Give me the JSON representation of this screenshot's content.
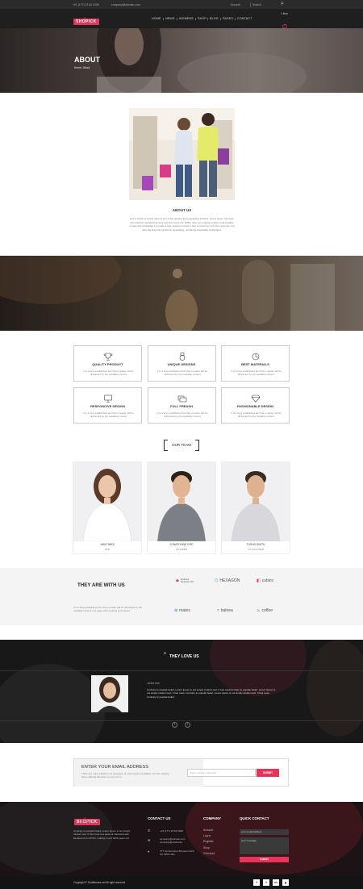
{
  "topbar": {
    "phone": "+01 (177) 23 84 0208",
    "email": "company@domain.com",
    "account": "Account",
    "search_placeholder": "Search"
  },
  "header": {
    "logo": "SHOPICK",
    "nav": [
      "HOME",
      "NEWS",
      "WOMENS",
      "SHOP",
      "BLOG",
      "PAGES",
      "CONTACT"
    ],
    "cart": "1 Item"
  },
  "hero": {
    "title": "ABOUT",
    "breadcrumb": "Home  /  About"
  },
  "about": {
    "title": "ABOUT US",
    "text": "Lorem ipsum is simply dummy text of the printing and typesetting industry. Lorem ipsum has been the industry's standard dummy text ever since the 1500s, when an unknown printer took a galley of type and scrambled it to make a type specimen book. It has survived not only five centuries, but also the leap into electronic typesetting, remaining essentially unchanged."
  },
  "features": [
    {
      "title": "QUALITY PRODUCT",
      "icon": "trophy-icon",
      "desc": "It is a long established fact that a reader will be distracted by the readable content"
    },
    {
      "title": "UNIQUE DESIGNS",
      "icon": "medal-icon",
      "desc": "It is a long established fact that a reader will be distracted by the readable content"
    },
    {
      "title": "BEST MATERIALS",
      "icon": "pie-chart-icon",
      "desc": "It is a long established fact that a reader will be distracted by the readable content"
    },
    {
      "title": "RESPONCIVE DESIGN",
      "icon": "monitor-icon",
      "desc": "It is a long established fact that a reader will be distracted by the readable content"
    },
    {
      "title": "FULL FREASH",
      "icon": "windows-icon",
      "desc": "It is a long established fact that a reader will be distracted by the readable content"
    },
    {
      "title": "FASHIONABLE DESIGN",
      "icon": "diamond-icon",
      "desc": "It is a long established fact that a reader will be distracted by the readable content"
    }
  ],
  "team": {
    "title": "OUR TEAM",
    "members": [
      {
        "name": "JANE MIKE",
        "role": "CEO"
      },
      {
        "name": "JONATHONE DOE",
        "role": "FAUNDER"
      },
      {
        "name": "TUSHS SMITH",
        "role": "CO-FAUNDER"
      }
    ]
  },
  "partners": {
    "title": "THEY ARE WITH US",
    "text": "It is a long established fact that a reader will be distracted by the readable content of a page when looking at its layout.",
    "brands": [
      "Sunburst Semantic LTD",
      "HEXAGON",
      "cubico",
      "mates",
      "balnea",
      "coffee"
    ]
  },
  "testimonial": {
    "title": "THEY LOVE US",
    "name": "Jorine doe",
    "text": "Contrary to popular belief, Lorem Ipsum is not simply random text. It has rootsContrary to popular belief, Lorem Ipsum is not simply random text. It has roots. Contrary to popular belief, Lorem Ipsum is not simply random text. It has roots Contrary to popular belief.",
    "prev": "‹",
    "next": "›"
  },
  "newsletter": {
    "title": "ENTER YOUR EMAIL ADDRESS",
    "text": "There are many variations of passages of Lorem Ipsum available, but the majority have suffered alteration in some form.",
    "placeholder": "Enter email to subscribe",
    "button": "SUBMIT"
  },
  "footer": {
    "logo": "SHOPICK",
    "about": "Contrary to popular belief, Lorem Ipsum is not simply random text. It has roots in a piece of classical Latin literature from 45 BC, making it over 2000 years old.",
    "contact_title": "CONTACT US",
    "phone": "+01 (177) 23 84 0208",
    "email": "company@domain.com\ncompany@email.info",
    "address": "777 Up Dumpure Brescoe North SC 0050 USA",
    "company_title": "COMPANY",
    "company_links": [
      "Account",
      "Log in",
      "Register",
      "Shop",
      "Checkout"
    ],
    "quick_title": "QUICK CONTACT",
    "email_placeholder": "your email address",
    "message_placeholder": "your message",
    "send": "SUBMIT",
    "copyright": "Copyright © Godthemes.net All right reserved",
    "social": [
      "f",
      "t",
      "in",
      "g"
    ]
  },
  "colors": {
    "accent": "#e8345a",
    "dark": "#1f1f1f"
  }
}
